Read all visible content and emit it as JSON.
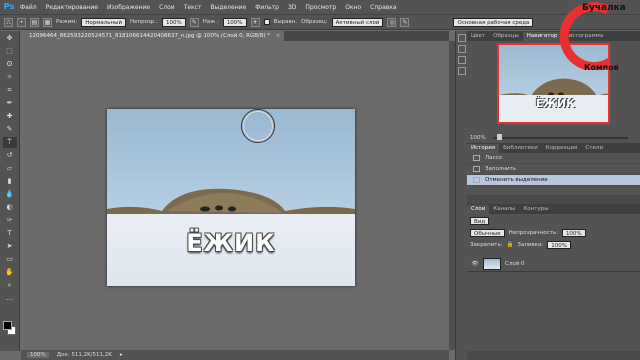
{
  "menubar": {
    "logo": "Ps",
    "items": [
      "Файл",
      "Редактирование",
      "Изображение",
      "Слои",
      "Текст",
      "Выделение",
      "Фильтр",
      "3D",
      "Просмотр",
      "Окно",
      "Справка"
    ]
  },
  "options": {
    "mode_label": "Режим:",
    "mode_value": "Нормальный",
    "opacity_label": "Непрозр.:",
    "opacity_value": "100%",
    "pressure_label": "Наж.:",
    "pressure_value": "100%",
    "aligned_label": "Выравн.",
    "sample_label": "Образец:",
    "sample_value": "Активный слой",
    "workspace_value": "Основная рабочая среда"
  },
  "document": {
    "tab_title": "12096464_862593220524571_818106614420408637_n.jpg @ 100% (Слой 0, RGB/8) *",
    "caption": "ЁЖИК",
    "zoom": "100%",
    "doc_size": "Док: 511,2K/511,2K"
  },
  "navigator": {
    "tabs": [
      "Цвет",
      "Образцы",
      "Навигатор",
      "Гистограмма"
    ],
    "active_tab": "Навигатор",
    "caption": "ЁЖИК",
    "zoom": "100%"
  },
  "history": {
    "tabs": [
      "История",
      "Библиотеки",
      "Коррекция",
      "Стили"
    ],
    "items": [
      "Лассо",
      "Заполнить",
      "Отменить выделение"
    ],
    "selected": "Отменить выделение"
  },
  "layers": {
    "tabs": [
      "Слои",
      "Каналы",
      "Контуры"
    ],
    "kind_value": "Вид",
    "blend_value": "Обычные",
    "opacity_label": "Непрозрачность:",
    "opacity_value": "100%",
    "lock_label": "Закрепить:",
    "fill_label": "Заливка:",
    "fill_value": "100%",
    "layer_name": "Слой 0"
  },
  "watermark": {
    "line1": "Бучалка",
    "line2": "Компов"
  },
  "colors": {
    "accent": "#e83030",
    "selection": "#b8c7dd",
    "panel": "#535353"
  }
}
